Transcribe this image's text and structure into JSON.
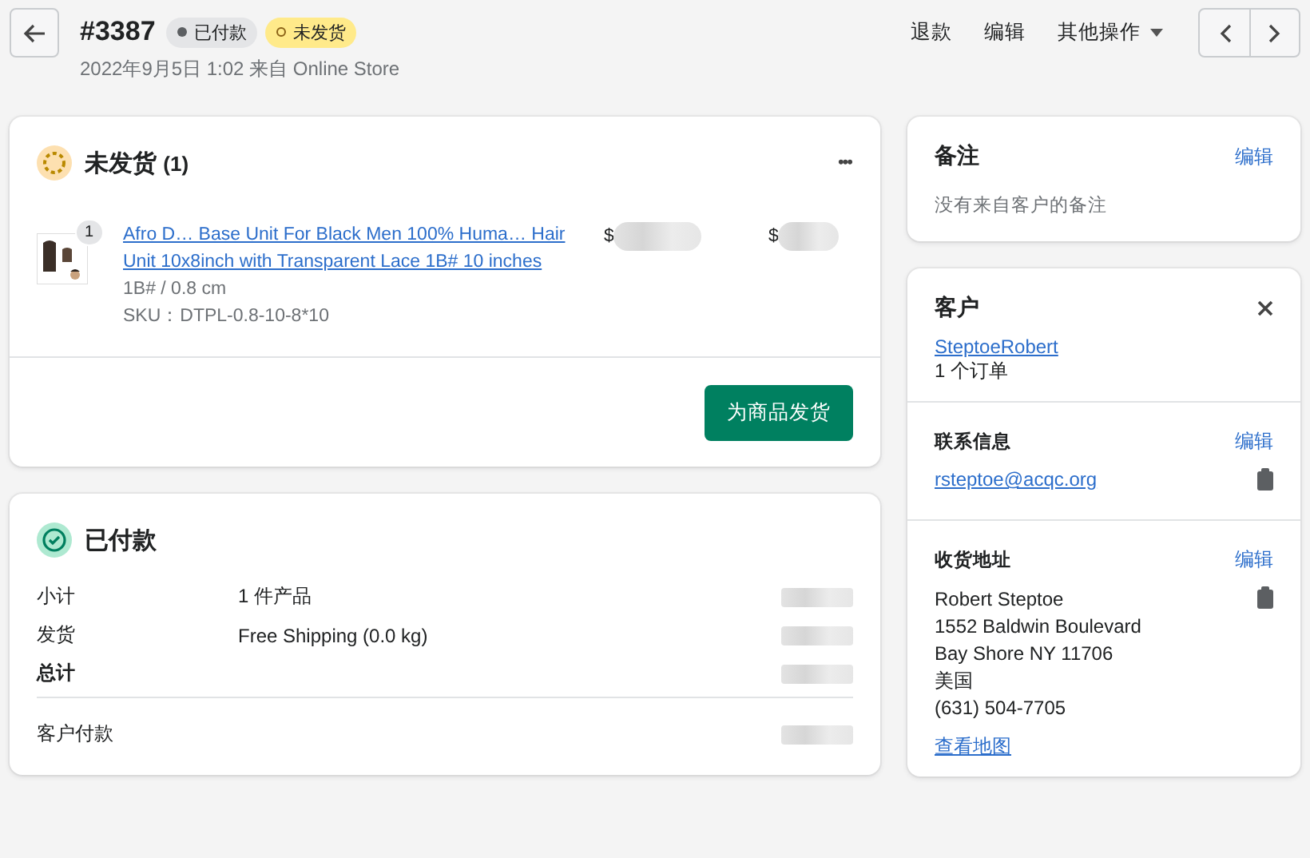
{
  "header": {
    "order_number": "#3387",
    "badges": [
      {
        "label": "已付款",
        "kind": "paid"
      },
      {
        "label": "未发货",
        "kind": "unfulfilled"
      }
    ],
    "subtitle": "2022年9月5日 1:02 来自 Online Store",
    "actions": [
      "退款",
      "编辑"
    ],
    "more_actions": "其他操作"
  },
  "unfulfilled": {
    "title": "未发货",
    "count": "(1)",
    "menu": "•••",
    "item": {
      "quantity": "1",
      "title": "Afro D… Base Unit For Black Men 100% Huma… Hair Unit 10x8inch with Transparent Lace 1B# 10 inches",
      "variant": "1B# / 0.8 cm",
      "sku": "SKU：DTPL-0.8-10-8*10",
      "price_prefix": "$",
      "total_prefix": "$"
    },
    "button": "为商品发货"
  },
  "payment": {
    "title": "已付款",
    "rows": [
      {
        "label": "小计",
        "detail": "1 件产品",
        "bold": false
      },
      {
        "label": "发货",
        "detail": "Free Shipping (0.0 kg)",
        "bold": false
      },
      {
        "label": "总计",
        "detail": "",
        "bold": true
      }
    ],
    "paid_label": "客户付款"
  },
  "notes": {
    "title": "备注",
    "edit": "编辑",
    "text": "没有来自客户的备注"
  },
  "customer": {
    "title": "客户",
    "name": "SteptoeRobert",
    "orders": "1 个订单",
    "contact_title": "联系信息",
    "contact_edit": "编辑",
    "email": "rsteptoe@acqc.org",
    "address_title": "收货地址",
    "address_edit": "编辑",
    "address_lines": [
      "Robert Steptoe",
      "1552 Baldwin Boulevard",
      "Bay Shore NY 11706",
      "美国",
      "(631) 504-7705"
    ],
    "map_link": "查看地图"
  }
}
